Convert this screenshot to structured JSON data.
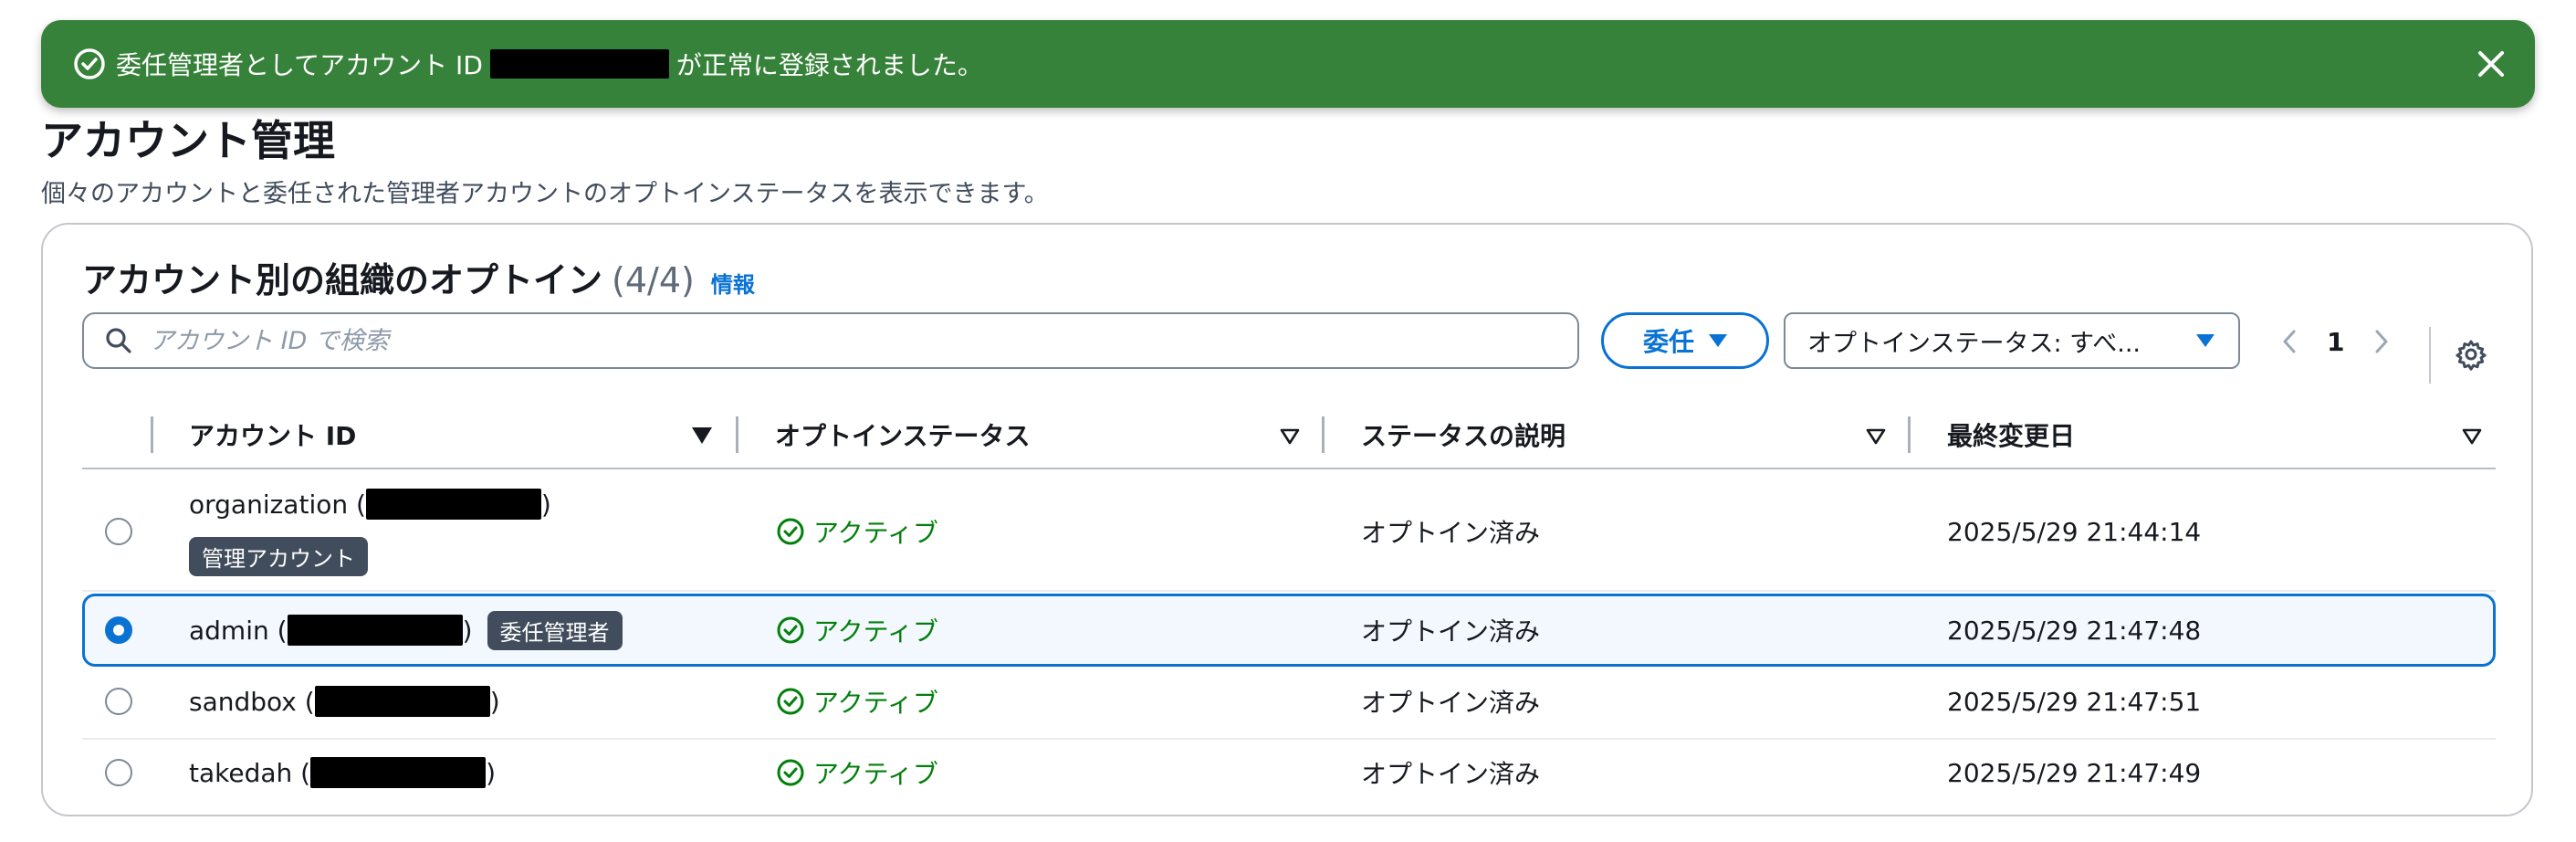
{
  "flash": {
    "message_before": "委任管理者としてアカウント ID",
    "message_after": "が正常に登録されました。"
  },
  "page": {
    "title": "アカウント管理",
    "description": "個々のアカウントと委任された管理者アカウントのオプトインステータスを表示できます。"
  },
  "table": {
    "title": "アカウント別の組織のオプトイン",
    "count": "(4/4)",
    "info_link": "情報",
    "search_placeholder": "アカウント ID で検索",
    "delegate_button": "委任",
    "filter_select": "オプトインステータス: すべ...",
    "current_page": "1",
    "columns": [
      "アカウント ID",
      "オプトインステータス",
      "ステータスの説明",
      "最終変更日"
    ],
    "rows": [
      {
        "name": "organization (",
        "suffix": ")",
        "badge": "管理アカウント",
        "status": "アクティブ",
        "description": "オプトイン済み",
        "modified": "2025/5/29 21:44:14",
        "selected": false
      },
      {
        "name": "admin (",
        "suffix": ")",
        "badge": "委任管理者",
        "status": "アクティブ",
        "description": "オプトイン済み",
        "modified": "2025/5/29 21:47:48",
        "selected": true
      },
      {
        "name": "sandbox (",
        "suffix": ")",
        "badge": "",
        "status": "アクティブ",
        "description": "オプトイン済み",
        "modified": "2025/5/29 21:47:51",
        "selected": false
      },
      {
        "name": "takedah (",
        "suffix": ")",
        "badge": "",
        "status": "アクティブ",
        "description": "オプトイン済み",
        "modified": "2025/5/29 21:47:49",
        "selected": false
      }
    ]
  },
  "colors": {
    "success": "#37823a",
    "accent": "#0972d3",
    "status_ok": "#037f0c"
  }
}
